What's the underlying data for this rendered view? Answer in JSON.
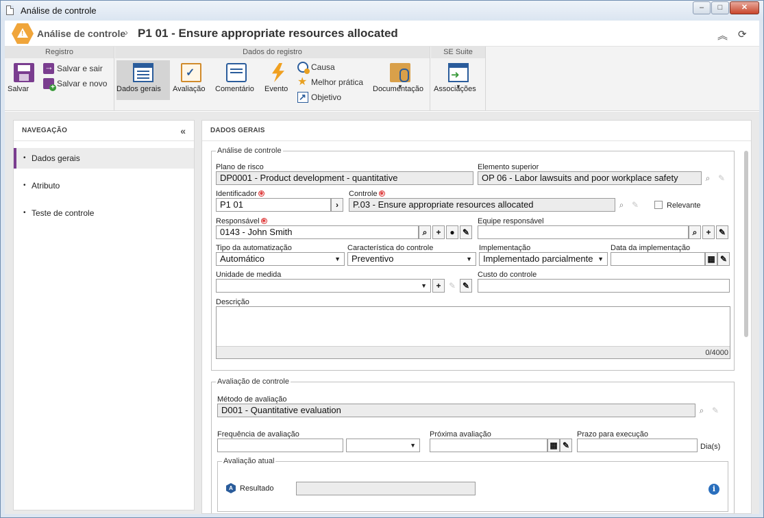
{
  "window": {
    "title": "Análise de controle"
  },
  "header": {
    "breadcrumb": "Análise de controle",
    "separator": "›",
    "title": "P1 01 - Ensure appropriate resources allocated"
  },
  "ribbon": {
    "registro": {
      "title": "Registro",
      "save": "Salvar",
      "save_exit": "Salvar e sair",
      "save_new": "Salvar e novo"
    },
    "dados": {
      "title": "Dados do registro",
      "general": "Dados gerais",
      "evaluation": "Avaliação",
      "comment": "Comentário",
      "event": "Evento",
      "cause": "Causa",
      "best_practice": "Melhor prática",
      "objective": "Objetivo",
      "documentation": "Documentação"
    },
    "suite": {
      "title": "SE Suite",
      "associations": "Associações"
    }
  },
  "nav": {
    "title": "NAVEGAÇÃO",
    "items": [
      {
        "label": "Dados gerais",
        "active": true
      },
      {
        "label": "Atributo"
      },
      {
        "label": "Teste de controle"
      }
    ]
  },
  "main": {
    "title": "DADOS GERAIS",
    "analysis": {
      "legend": "Análise de controle",
      "risk_plan_label": "Plano de risco",
      "risk_plan": "DP0001 - Product development - quantitative",
      "parent_label": "Elemento superior",
      "parent": "OP 06 - Labor lawsuits and poor workplace safety",
      "identifier_label": "Identificador",
      "identifier": "P1 01",
      "control_label": "Controle",
      "control": "P.03 - Ensure appropriate resources allocated",
      "relevant_label": "Relevante",
      "responsible_label": "Responsável",
      "responsible": "0143 - John Smith",
      "team_label": "Equipe responsável",
      "team": "",
      "automation_label": "Tipo da automatização",
      "automation": "Automático",
      "characteristic_label": "Característica do controle",
      "characteristic": "Preventivo",
      "implementation_label": "Implementação",
      "implementation": "Implementado parcialmente",
      "impl_date_label": "Data da implementação",
      "impl_date": "",
      "unit_label": "Unidade de medida",
      "unit": "",
      "cost_label": "Custo do controle",
      "cost": "",
      "description_label": "Descrição",
      "description_counter": "0/4000"
    },
    "evaluation": {
      "legend": "Avaliação de controle",
      "method_label": "Método de avaliação",
      "method": "D001 - Quantitative evaluation",
      "frequency_label": "Frequência de avaliação",
      "next_label": "Próxima avaliação",
      "deadline_label": "Prazo para execução",
      "deadline_unit": "Dia(s)",
      "current": {
        "legend": "Avaliação atual",
        "result_label": "Resultado",
        "result": ""
      }
    }
  }
}
